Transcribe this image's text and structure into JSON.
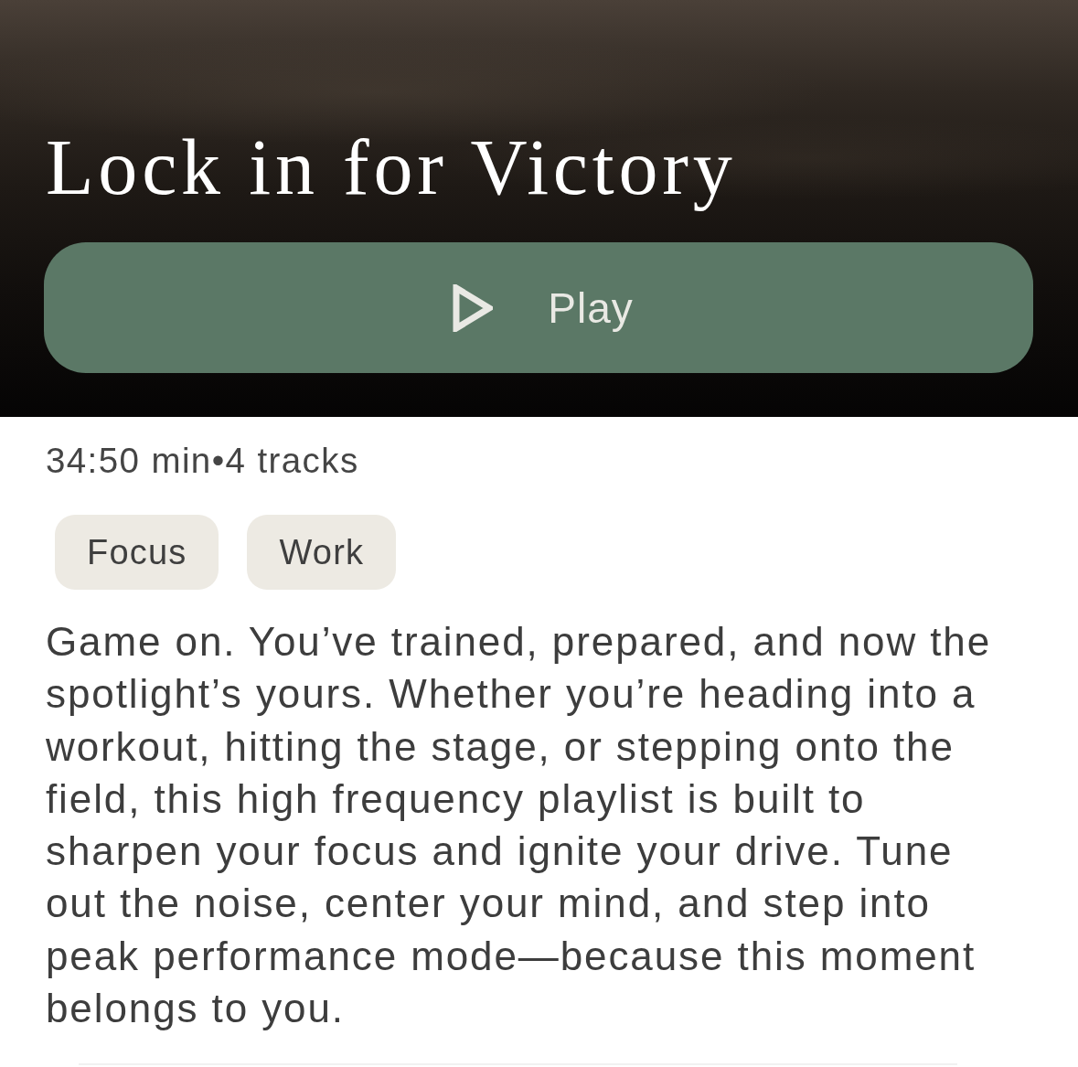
{
  "header": {
    "title": "Lock in for Victory",
    "play_button": {
      "label": "Play"
    }
  },
  "meta": "34:50 min•4 tracks",
  "tags": [
    {
      "label": "Focus"
    },
    {
      "label": "Work"
    }
  ],
  "description": "Game on. You’ve trained, prepared, and now the spotlight’s yours. Whether you’re heading into a workout, hitting the stage, or stepping onto the field, this high frequency playlist is built to sharpen your focus and ignite your drive. Tune out the noise, center your mind, and step into peak performance mode—because this moment belongs to you."
}
